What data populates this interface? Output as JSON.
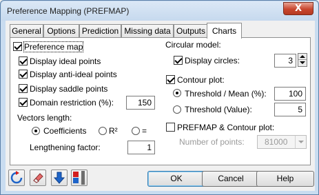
{
  "window": {
    "title": "Preference Mapping (PREFMAP)",
    "close_label": "X"
  },
  "tabs": [
    {
      "label": "General",
      "active": false
    },
    {
      "label": "Options",
      "active": false
    },
    {
      "label": "Prediction",
      "active": false
    },
    {
      "label": "Missing data",
      "active": false
    },
    {
      "label": "Outputs",
      "active": false
    },
    {
      "label": "Charts",
      "active": true
    }
  ],
  "left": {
    "preference_map": {
      "label": "Preference map",
      "checked": true
    },
    "display_ideal": {
      "label": "Display ideal points",
      "checked": true
    },
    "display_anti_ideal": {
      "label": "Display anti-ideal points",
      "checked": true
    },
    "display_saddle": {
      "label": "Display saddle points",
      "checked": true
    },
    "domain_restriction": {
      "label": "Domain restriction (%):",
      "checked": true,
      "value": "150"
    },
    "vectors_length": {
      "heading": "Vectors length:",
      "options": [
        {
          "label": "Coefficients",
          "checked": true
        },
        {
          "label": "R²",
          "checked": false
        },
        {
          "label": "=",
          "checked": false
        }
      ]
    },
    "lengthening_factor": {
      "label": "Lengthening factor:",
      "value": "1"
    }
  },
  "right": {
    "circular_model": {
      "heading": "Circular model:"
    },
    "display_circles": {
      "label": "Display circles:",
      "checked": true,
      "value": "3"
    },
    "contour_plot": {
      "label": "Contour plot:",
      "checked": true
    },
    "threshold_mean": {
      "label": "Threshold / Mean (%):",
      "checked": true,
      "value": "100"
    },
    "threshold_value": {
      "label": "Threshold (Value):",
      "checked": false,
      "value": "5"
    },
    "prefmap_contour": {
      "label": "PREFMAP & Contour plot:",
      "checked": false
    },
    "number_of_points": {
      "label": "Number of points:",
      "value": "81000"
    }
  },
  "buttons": {
    "ok": "OK",
    "cancel": "Cancel",
    "help": "Help"
  },
  "toolbar_icons": [
    "reset-icon",
    "eraser-icon",
    "arrow-down-icon",
    "layout-icon"
  ],
  "colors": {
    "titlebar": "#c6d9ee",
    "close": "#c8462e",
    "accent_blue": "#1e64c8",
    "accent_red": "#d21e1e"
  }
}
